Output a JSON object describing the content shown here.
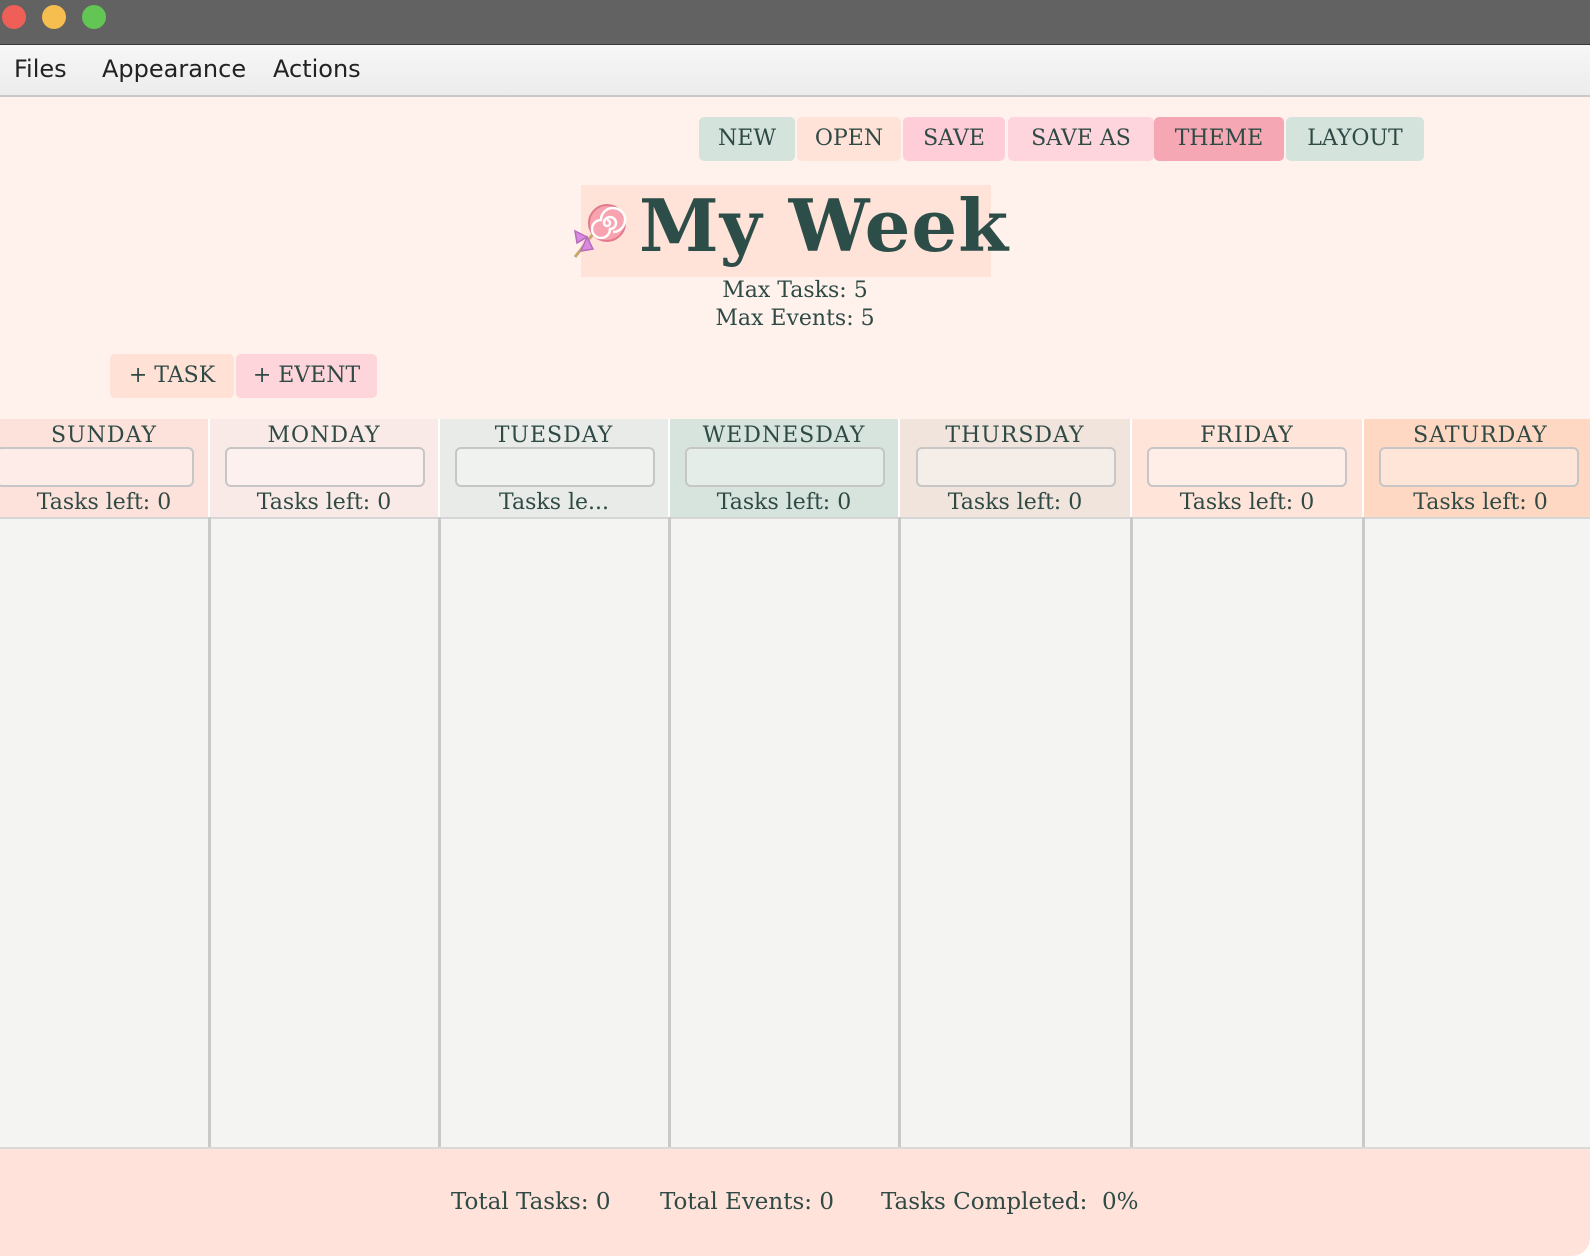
{
  "window": {
    "controls": [
      {
        "name": "close",
        "color": "#ee5f57"
      },
      {
        "name": "minimize",
        "color": "#f5be4f"
      },
      {
        "name": "maximize",
        "color": "#62c554"
      }
    ]
  },
  "menubar": {
    "items": [
      "Files",
      "Appearance",
      "Actions"
    ]
  },
  "toolbar": {
    "new_label": "NEW",
    "open_label": "OPEN",
    "save_label": "SAVE",
    "save_as_label": "SAVE AS",
    "theme_label": "THEME",
    "layout_label": "LAYOUT"
  },
  "header": {
    "icon": "lollipop-icon",
    "title": "My Week",
    "max_tasks": "Max Tasks: 5",
    "max_events": "Max Events: 5"
  },
  "actions": {
    "add_task_label": "+ TASK",
    "add_event_label": "+ EVENT"
  },
  "days": [
    {
      "name": "SUNDAY",
      "tasks_left": "Tasks left: 0",
      "color": "#fde2dc"
    },
    {
      "name": "MONDAY",
      "tasks_left": "Tasks left: 0",
      "color": "#faeae7"
    },
    {
      "name": "TUESDAY",
      "tasks_left": "Tasks le...",
      "color": "#e8ebe7"
    },
    {
      "name": "WEDNESDAY",
      "tasks_left": "Tasks left: 0",
      "color": "#d7e4de"
    },
    {
      "name": "THURSDAY",
      "tasks_left": "Tasks left: 0",
      "color": "#f0e4dc"
    },
    {
      "name": "FRIDAY",
      "tasks_left": "Tasks left: 0",
      "color": "#ffe4da"
    },
    {
      "name": "SATURDAY",
      "tasks_left": "Tasks left: 0",
      "color": "#ffd8c4"
    }
  ],
  "footer": {
    "total_tasks": "Total Tasks: 0",
    "total_events": "Total Events: 0",
    "tasks_completed": "Tasks Completed:  0%"
  },
  "colors": {
    "header_bg": "#fff1ec",
    "text": "#2f4a45",
    "btn_green": "#d5e3dd",
    "btn_peach": "#ffe3d8",
    "btn_pink": "#ffcdd8",
    "btn_pink_dark": "#f5a8b3"
  }
}
